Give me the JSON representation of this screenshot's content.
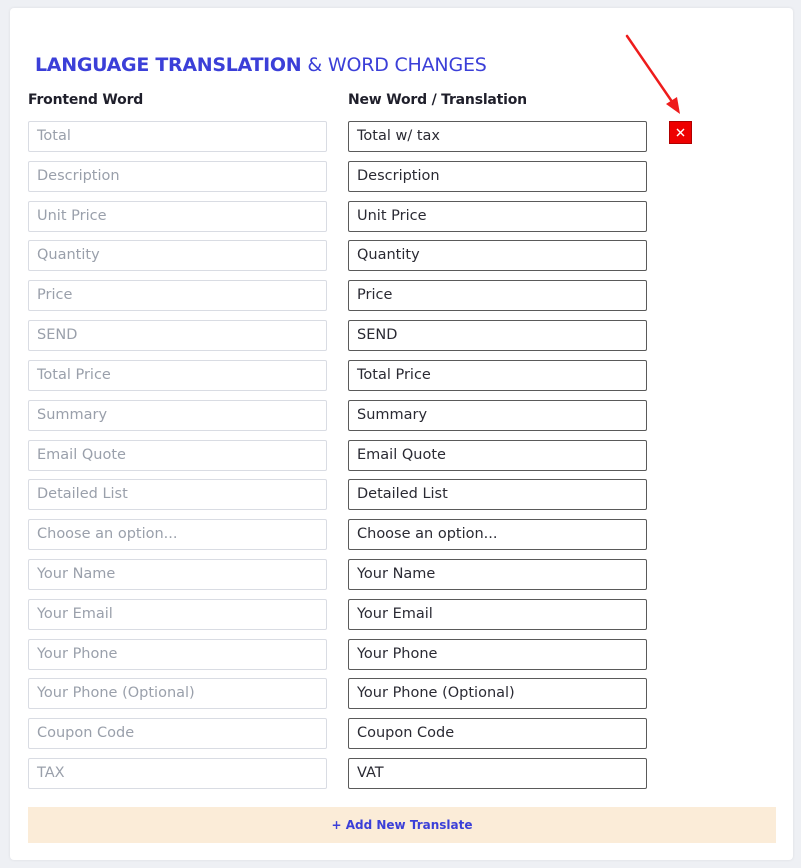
{
  "header": {
    "title_strong": "LANGUAGE TRANSLATION",
    "title_light": "& WORD CHANGES"
  },
  "columns": {
    "frontend_label": "Frontend Word",
    "translation_label": "New Word / Translation"
  },
  "rows": [
    {
      "frontend": "Total",
      "translation": "Total w/ tax"
    },
    {
      "frontend": "Description",
      "translation": "Description"
    },
    {
      "frontend": "Unit Price",
      "translation": "Unit Price"
    },
    {
      "frontend": "Quantity",
      "translation": "Quantity"
    },
    {
      "frontend": "Price",
      "translation": "Price"
    },
    {
      "frontend": "SEND",
      "translation": "SEND"
    },
    {
      "frontend": "Total Price",
      "translation": "Total Price"
    },
    {
      "frontend": "Summary",
      "translation": "Summary"
    },
    {
      "frontend": "Email Quote",
      "translation": "Email Quote"
    },
    {
      "frontend": "Detailed List",
      "translation": "Detailed List"
    },
    {
      "frontend": "Choose an option...",
      "translation": "Choose an option..."
    },
    {
      "frontend": "Your Name",
      "translation": "Your Name"
    },
    {
      "frontend": "Your Email",
      "translation": "Your Email"
    },
    {
      "frontend": "Your Phone",
      "translation": "Your Phone"
    },
    {
      "frontend": "Your Phone (Optional)",
      "translation": "Your Phone (Optional)"
    },
    {
      "frontend": "Coupon Code",
      "translation": "Coupon Code"
    },
    {
      "frontend": "TAX",
      "translation": "VAT"
    }
  ],
  "delete_button": {
    "glyph": "×",
    "icon": "close-icon",
    "color": "#ee0000"
  },
  "annotation": {
    "icon": "red-arrow-icon",
    "color": "#ee1c1c"
  },
  "footer": {
    "add_label": "+ Add New Translate"
  },
  "colors": {
    "accent": "#3b3fd8",
    "add_bar_bg": "#fbecd8"
  }
}
